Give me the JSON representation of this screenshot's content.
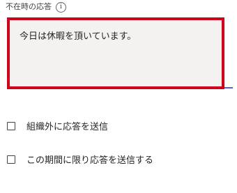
{
  "auto_reply": {
    "label": "不在時の応答",
    "info_icon": "ⓘ",
    "message": "今日は休暇を頂いています。"
  },
  "options": [
    {
      "label": "組織外に応答を送信",
      "checked": false
    },
    {
      "label": "この期間に限り応答を送信する",
      "checked": false
    }
  ],
  "colors": {
    "highlight_border": "#d0021b",
    "field_bg": "#f3f2f1",
    "focus_underline": "#5b5fc7"
  }
}
